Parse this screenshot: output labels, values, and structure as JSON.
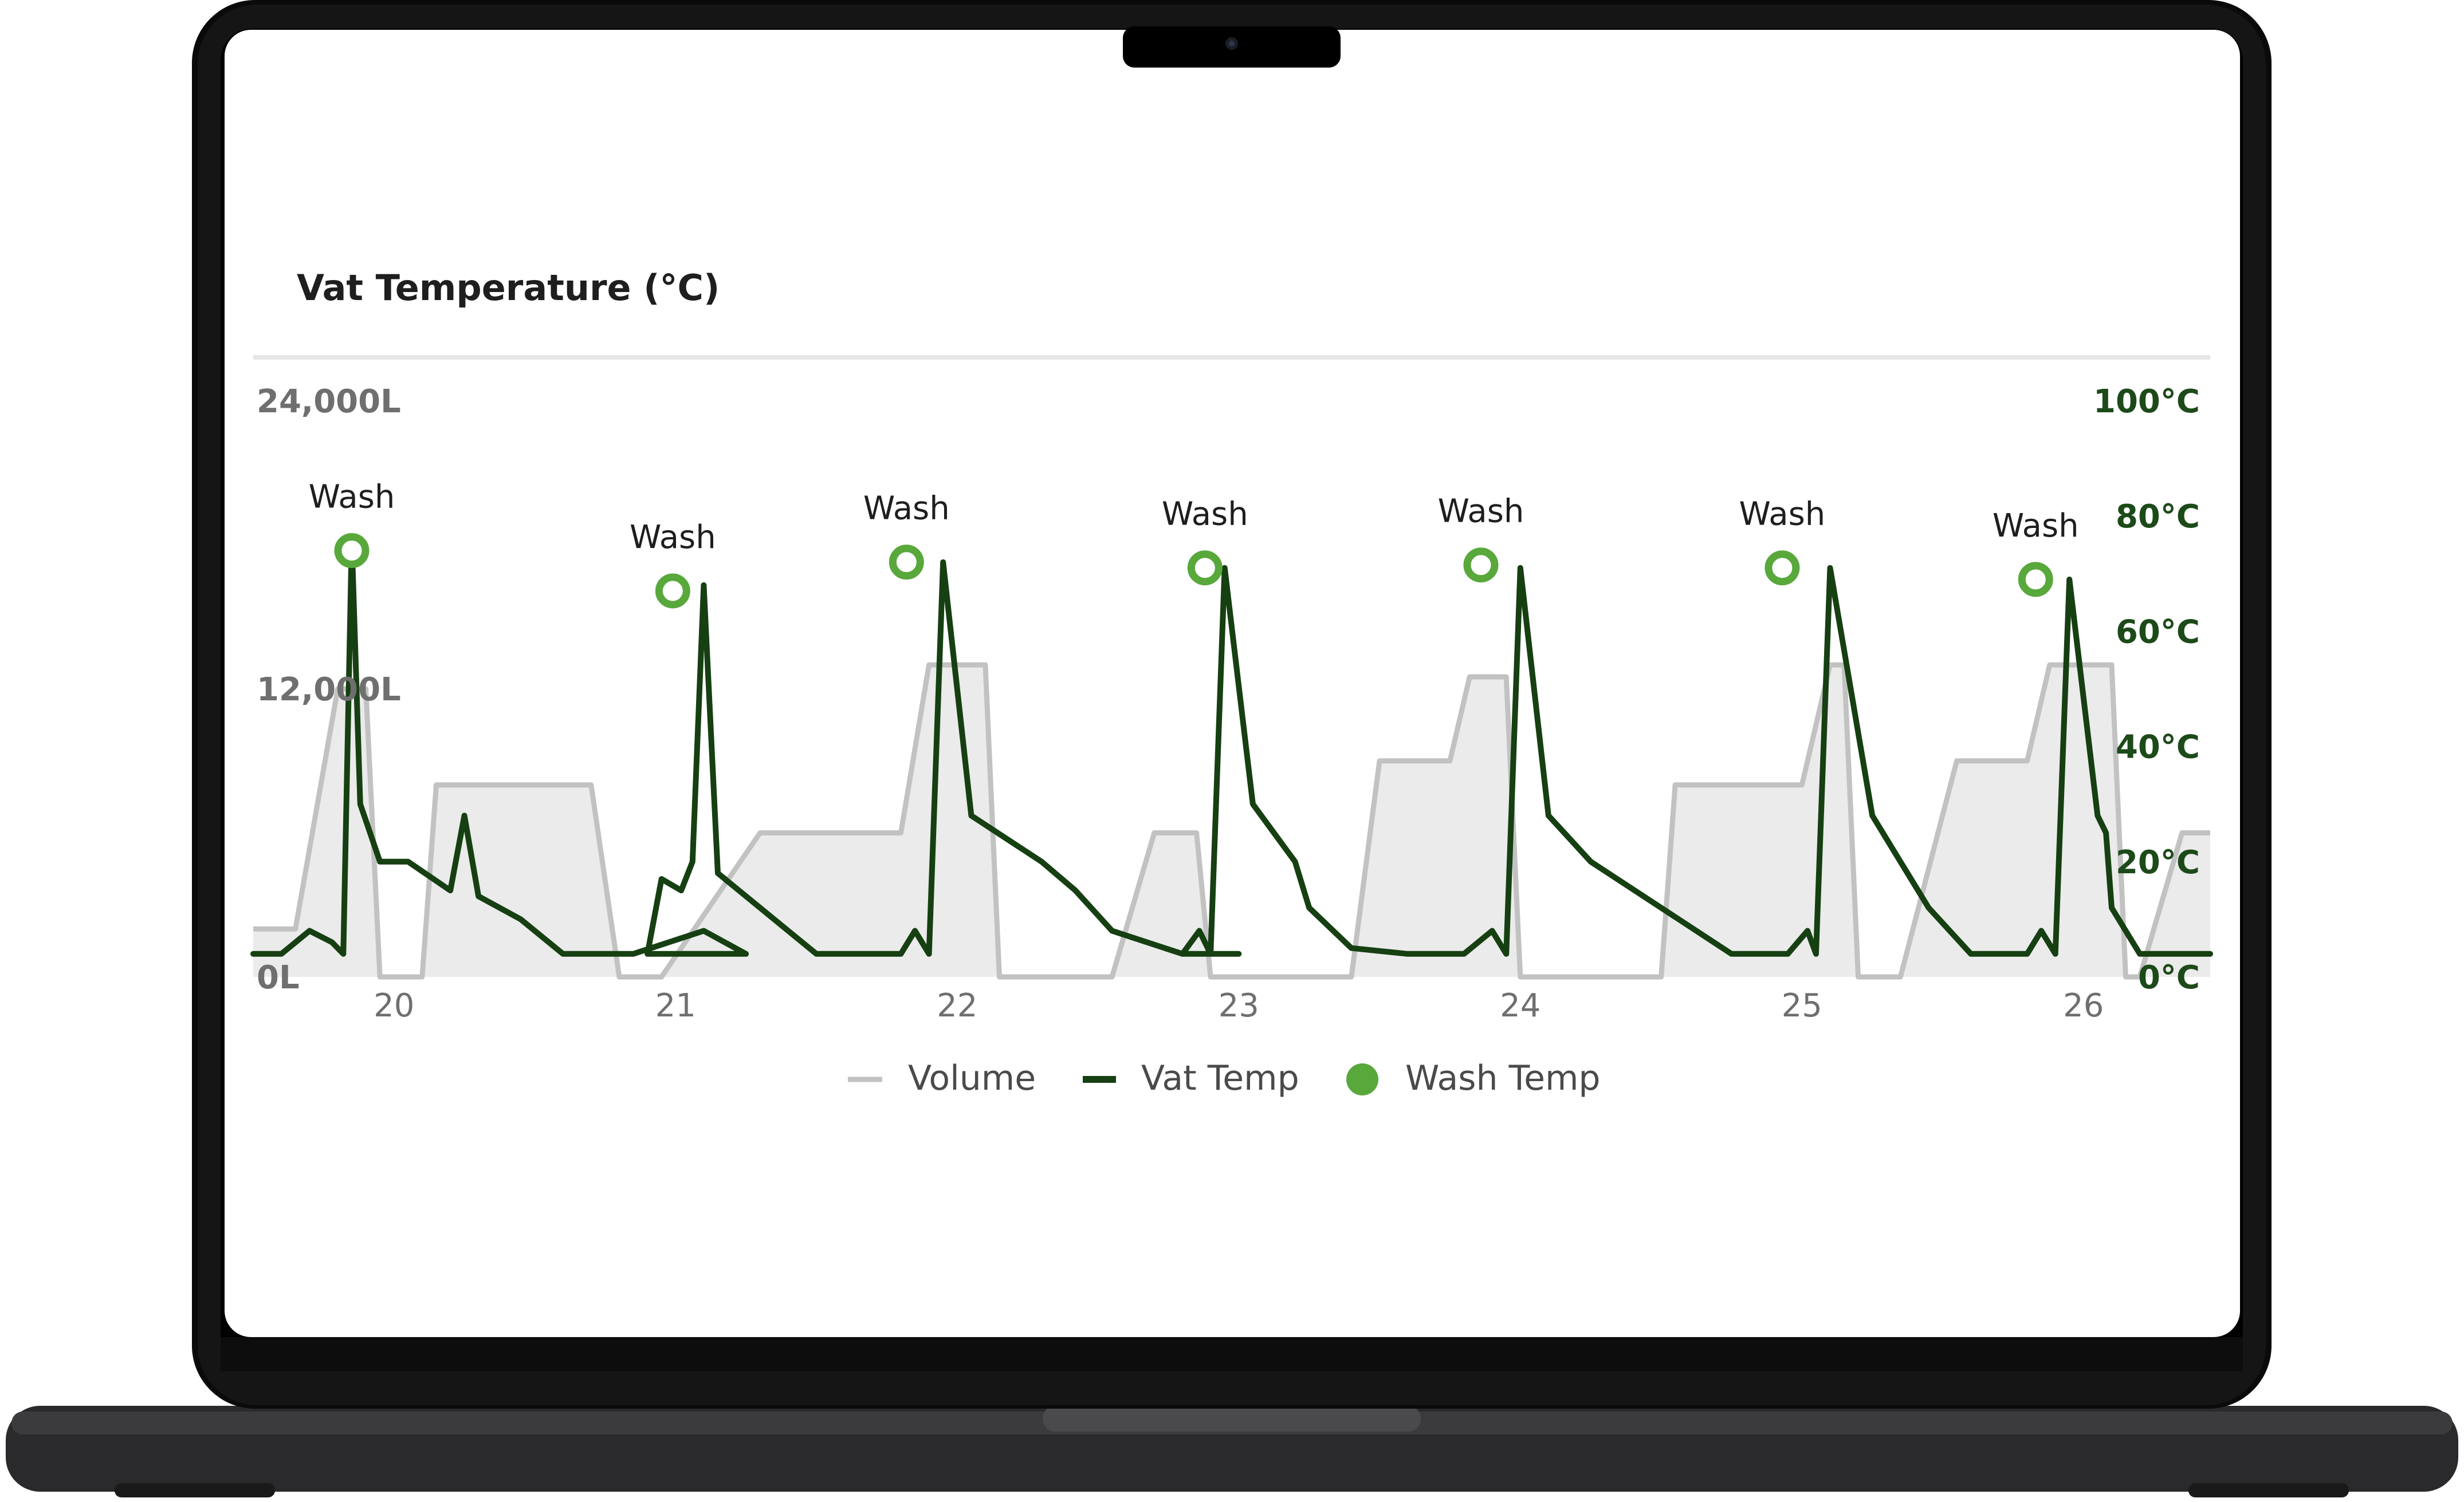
{
  "colors": {
    "volume_stroke": "#c2c2c2",
    "volume_fill": "#ebebeb",
    "vat_temp": "#163f12",
    "wash_marker": "#58a83c",
    "title": "#1e1e1e",
    "axis_left": "#6f6f6f",
    "axis_right": "#1c4a19",
    "tick": "#6f6f6f",
    "legend_text": "#4a4a4a"
  },
  "chart_data": {
    "type": "line",
    "title": "Vat Temperature (°C)",
    "x": [
      19.5,
      19.6,
      19.7,
      19.78,
      19.82,
      19.85,
      19.88,
      19.95,
      20.05,
      20.2,
      20.25,
      20.3,
      20.45,
      20.6,
      20.85,
      21.1,
      21.25,
      20.9,
      20.95,
      21.02,
      21.06,
      21.1,
      21.15,
      21.3,
      21.5,
      21.8,
      21.85,
      21.9,
      21.95,
      22.05,
      22.3,
      22.42,
      22.55,
      22.8,
      23.0,
      22.8,
      22.86,
      22.9,
      22.95,
      23.05,
      23.2,
      23.25,
      23.4,
      23.6,
      23.8,
      23.9,
      23.95,
      24.0,
      24.1,
      24.25,
      24.5,
      24.75,
      24.95,
      25.02,
      25.05,
      25.1,
      25.25,
      25.35,
      25.45,
      25.6,
      25.8,
      25.85,
      25.9,
      25.95,
      26.05,
      26.08,
      26.1,
      26.2,
      26.45
    ],
    "series": [
      {
        "name": "Volume",
        "points": [
          [
            19.5,
            2000
          ],
          [
            19.65,
            2000
          ],
          [
            19.8,
            12000
          ],
          [
            19.9,
            12000
          ],
          [
            19.95,
            0
          ],
          [
            20.1,
            0
          ],
          [
            20.15,
            8000
          ],
          [
            20.7,
            8000
          ],
          [
            20.8,
            0
          ],
          [
            20.95,
            0
          ],
          [
            21.3,
            6000
          ],
          [
            21.8,
            6000
          ],
          [
            21.9,
            13000
          ],
          [
            22.1,
            13000
          ],
          [
            22.15,
            0
          ],
          [
            22.55,
            0
          ],
          [
            22.7,
            6000
          ],
          [
            22.85,
            6000
          ],
          [
            22.9,
            0
          ],
          [
            23.4,
            0
          ],
          [
            23.5,
            9000
          ],
          [
            23.75,
            9000
          ],
          [
            23.82,
            12500
          ],
          [
            23.95,
            12500
          ],
          [
            24.0,
            0
          ],
          [
            24.5,
            0
          ],
          [
            24.55,
            8000
          ],
          [
            25.0,
            8000
          ],
          [
            25.1,
            13000
          ],
          [
            25.15,
            13000
          ],
          [
            25.2,
            0
          ],
          [
            25.35,
            0
          ],
          [
            25.55,
            9000
          ],
          [
            25.8,
            9000
          ],
          [
            25.88,
            13000
          ],
          [
            26.1,
            13000
          ],
          [
            26.15,
            0
          ],
          [
            26.2,
            0
          ],
          [
            26.35,
            6000
          ],
          [
            26.45,
            6000
          ]
        ]
      },
      {
        "name": "Vat Temp",
        "values": [
          4,
          4,
          8,
          6,
          4,
          76,
          30,
          20,
          20,
          15,
          28,
          14,
          10,
          4,
          4,
          8,
          4,
          4,
          17,
          15,
          20,
          68,
          18,
          12,
          4,
          4,
          8,
          4,
          72,
          28,
          20,
          15,
          8,
          4,
          4,
          4,
          8,
          4,
          71,
          30,
          20,
          12,
          5,
          4,
          4,
          8,
          4,
          71,
          28,
          20,
          12,
          4,
          4,
          8,
          4,
          71,
          28,
          20,
          12,
          4,
          4,
          8,
          4,
          69,
          28,
          25,
          12,
          4,
          4
        ]
      },
      {
        "name": "Wash Temp",
        "points": [
          [
            19.85,
            74
          ],
          [
            20.99,
            67
          ],
          [
            21.82,
            72
          ],
          [
            22.88,
            71
          ],
          [
            23.86,
            71.5
          ],
          [
            24.93,
            71
          ],
          [
            25.83,
            69
          ]
        ]
      }
    ],
    "annotations": [
      "Wash",
      "Wash",
      "Wash",
      "Wash",
      "Wash",
      "Wash",
      "Wash"
    ],
    "x_ticks": [
      "20",
      "21",
      "22",
      "23",
      "24",
      "25",
      "26"
    ],
    "x_tick_values": [
      20,
      21,
      22,
      23,
      24,
      25,
      26
    ],
    "y_left_ticks": [
      "24,000L",
      "12,000L",
      "0L"
    ],
    "y_left_values": [
      24000,
      12000,
      0
    ],
    "y_right_ticks": [
      "100°C",
      "80°C",
      "60°C",
      "40°C",
      "20°C",
      "0°C"
    ],
    "y_right_values": [
      100,
      80,
      60,
      40,
      20,
      0
    ],
    "xlim": [
      19.5,
      26.45
    ],
    "ylim_left": [
      0,
      24000
    ],
    "ylim_right": [
      0,
      100
    ],
    "grid": false,
    "legend": {
      "placement": "bottom",
      "items": [
        "Volume",
        "Vat Temp",
        "Wash Temp"
      ]
    }
  }
}
